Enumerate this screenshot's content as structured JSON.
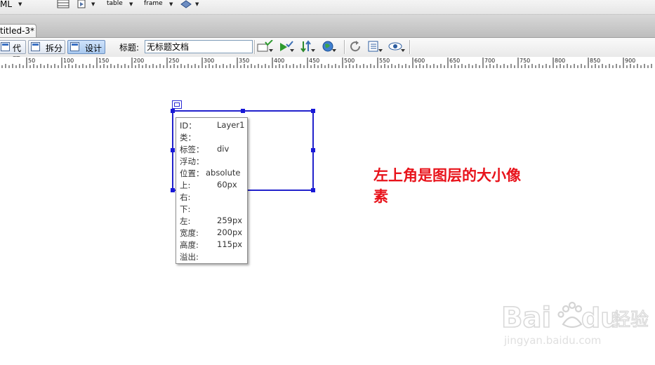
{
  "top_toolbar": {
    "html_label": "ML",
    "table_label": "table",
    "frame_label": "frame"
  },
  "document_tab": {
    "label": "titled-3*"
  },
  "doc_toolbar": {
    "code_label": "代码",
    "split_label": "拆分",
    "design_label": "设计",
    "active_view": "设计",
    "title_label": "标题:",
    "title_value": "无标题文档"
  },
  "ruler": {
    "ticks": [
      "50",
      "100",
      "150",
      "200",
      "250",
      "300",
      "350",
      "400",
      "450",
      "500",
      "550",
      "600",
      "650",
      "700",
      "750",
      "800",
      "850",
      "900"
    ]
  },
  "layer_tooltip": {
    "rows": [
      {
        "key": "ID：",
        "value": "Layer1"
      },
      {
        "key": "类：",
        "value": ""
      },
      {
        "key": "标签：",
        "value": "div"
      },
      {
        "key": "浮动：",
        "value": ""
      },
      {
        "key": "位置：",
        "value": "absolute"
      },
      {
        "key": "上:",
        "value": "60px"
      },
      {
        "key": "右:",
        "value": ""
      },
      {
        "key": "下:",
        "value": ""
      },
      {
        "key": "左:",
        "value": "259px"
      },
      {
        "key": "宽度:",
        "value": "200px"
      },
      {
        "key": "高度:",
        "value": "115px"
      },
      {
        "key": "溢出:",
        "value": ""
      }
    ]
  },
  "annotation": {
    "text": "左上角是图层的大小像\n素"
  },
  "watermark": {
    "brand": "Baidu",
    "suffix": "经验",
    "url": "jingyan.baidu.com"
  },
  "colors": {
    "annotation": "#e8131b",
    "layer_border": "#2222cc",
    "watermark": "#d4d4d4"
  }
}
